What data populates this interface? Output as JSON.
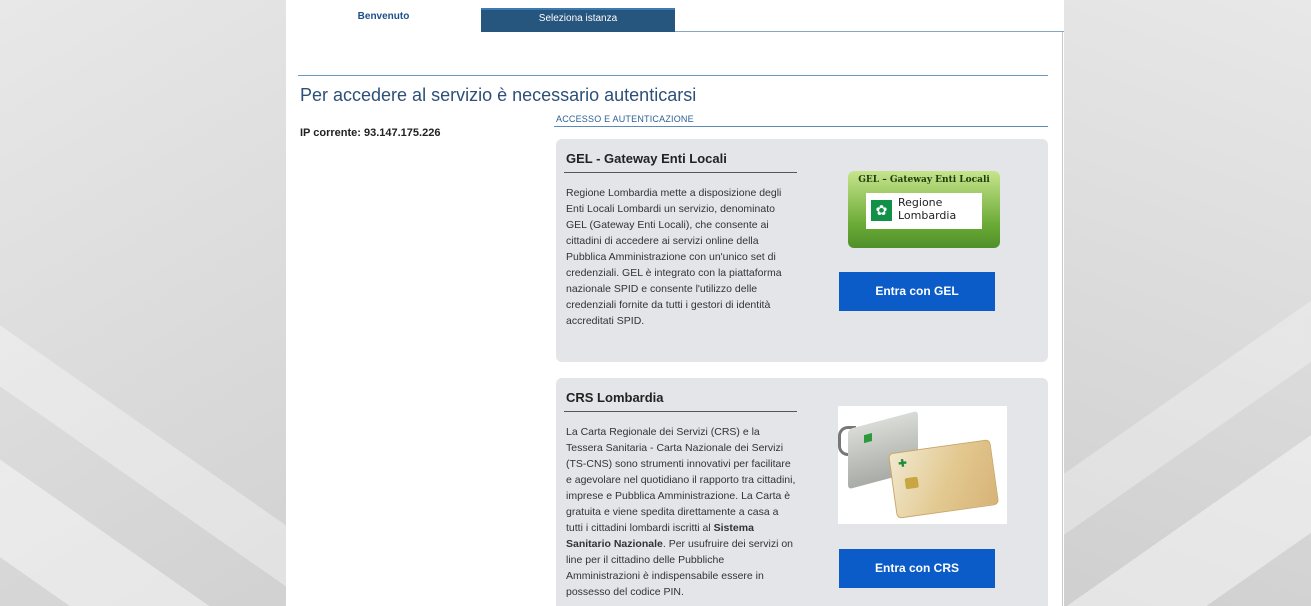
{
  "tabs": [
    {
      "label": "Benvenuto",
      "active": true
    },
    {
      "label": "Seleziona istanza",
      "active": false
    }
  ],
  "page_title": "Per accedere al servizio è necessario autenticarsi",
  "ip_label": "IP corrente: 93.147.175.226",
  "section_label": "ACCESSO E AUTENTICAZIONE",
  "cards": {
    "gel": {
      "title": "GEL - Gateway Enti Locali",
      "description": "Regione Lombardia mette a disposizione degli Enti Locali Lombardi un servizio, denominato GEL (Gateway Enti Locali), che consente ai cittadini di accedere ai servizi online della Pubblica Amministrazione con un'unico set di credenziali. GEL è integrato con la piattaforma nazionale SPID e consente l'utilizzo delle credenziali fornite da tutti i gestori di identità accreditati SPID.",
      "logo_title": "GEL – Gateway Enti Locali",
      "logo_name_line1": "Regione",
      "logo_name_line2": "Lombardia",
      "button_label": "Entra con GEL"
    },
    "crs": {
      "title": "CRS Lombardia",
      "description_part1": "La Carta Regionale dei Servizi (CRS) e la Tessera Sanitaria - Carta Nazionale dei Servizi (TS-CNS) sono strumenti innovativi per facilitare e agevolare nel quotidiano il rapporto tra cittadini, imprese e Pubblica Amministrazione. La Carta è gratuita e viene spedita direttamente a casa a tutti i cittadini lombardi iscritti al ",
      "description_bold": "Sistema Sanitario Nazionale",
      "description_part2": ". Per usufruire dei servizi on line per il cittadino delle Pubbliche Amministrazioni è indispensabile essere in possesso del codice PIN.",
      "button_label": "Entra con CRS"
    }
  },
  "colors": {
    "accent_button": "#0b5bc9",
    "title_blue": "#2d4f78",
    "tab_active_bg": "#26557e",
    "card_bg": "#e4e5e9"
  }
}
